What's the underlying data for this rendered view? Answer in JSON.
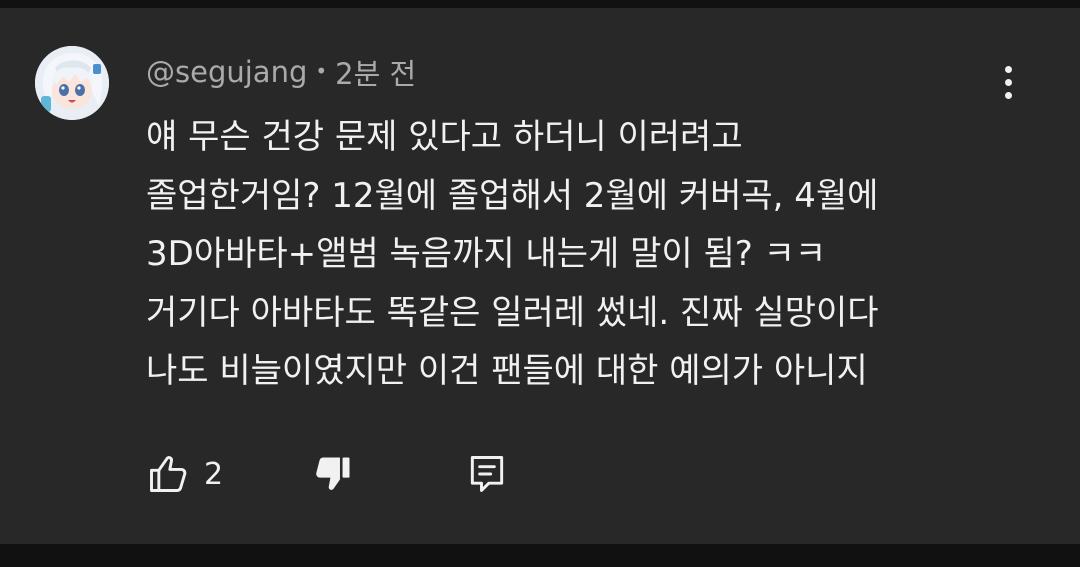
{
  "comment": {
    "author": "@segujang",
    "separator": "•",
    "timestamp": "2분 전",
    "lines": [
      "얘 무슨 건강 문제 있다고 하더니 이러려고",
      "졸업한거임? 12월에 졸업해서 2월에 커버곡, 4월에",
      "3D아바타+앨범 녹음까지 내는게 말이 됨? ㅋㅋ",
      "거기다 아바타도 똑같은 일러레 썼네. 진짜 실망이다",
      "나도 비늘이였지만 이건 팬들에 대한 예의가 아니지"
    ],
    "like_count": "2"
  },
  "icons": {
    "avatar": "anime-girl-avatar",
    "more": "more-vert-icon",
    "like": "thumb-up-outline-icon",
    "dislike": "thumb-down-filled-icon",
    "reply": "reply-comment-icon"
  },
  "colors": {
    "background": "#282828",
    "outer": "#111111",
    "text_primary": "#f1f1f1",
    "text_secondary": "#aaaaaa"
  }
}
